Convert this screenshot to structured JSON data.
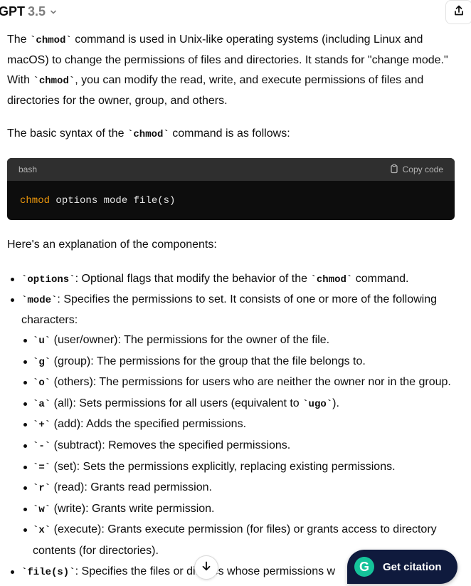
{
  "header": {
    "model_name": "GPT",
    "model_version": "3.5"
  },
  "intro": {
    "p1": [
      {
        "t": "The "
      },
      {
        "c": "`chmod`"
      },
      {
        "t": " command is used in Unix-like operating systems (including Linux and macOS) to change the permissions of files and directories. It stands for \"change mode.\" With "
      },
      {
        "c": "`chmod`"
      },
      {
        "t": ", you can modify the read, write, and execute permissions of files and directories for the owner, group, and others."
      }
    ],
    "p2": [
      {
        "t": "The basic syntax of the "
      },
      {
        "c": "`chmod`"
      },
      {
        "t": " command is as follows:"
      }
    ]
  },
  "code_block": {
    "language": "bash",
    "copy_label": "Copy code",
    "keyword": "chmod",
    "rest": " options mode file(s)"
  },
  "explanation_heading": "Here's an explanation of the components:",
  "items": [
    {
      "parts": [
        {
          "c": "`options`"
        },
        {
          "t": ": Optional flags that modify the behavior of the "
        },
        {
          "c": "`chmod`"
        },
        {
          "t": " command."
        }
      ]
    },
    {
      "parts": [
        {
          "c": "`mode`"
        },
        {
          "t": ": Specifies the permissions to set. It consists of one or more of the following characters:"
        }
      ],
      "sub": [
        {
          "parts": [
            {
              "c": "`u`"
            },
            {
              "t": " (user/owner): The permissions for the owner of the file."
            }
          ]
        },
        {
          "parts": [
            {
              "c": "`g`"
            },
            {
              "t": " (group): The permissions for the group that the file belongs to."
            }
          ]
        },
        {
          "parts": [
            {
              "c": "`o`"
            },
            {
              "t": " (others): The permissions for users who are neither the owner nor in the group."
            }
          ]
        },
        {
          "parts": [
            {
              "c": "`a`"
            },
            {
              "t": " (all): Sets permissions for all users (equivalent to "
            },
            {
              "c": "`ugo`"
            },
            {
              "t": ")."
            }
          ]
        },
        {
          "parts": [
            {
              "c": "`+`"
            },
            {
              "t": " (add): Adds the specified permissions."
            }
          ]
        },
        {
          "parts": [
            {
              "c": "`-`"
            },
            {
              "t": " (subtract): Removes the specified permissions."
            }
          ]
        },
        {
          "parts": [
            {
              "c": "`=`"
            },
            {
              "t": " (set): Sets the permissions explicitly, replacing existing permissions."
            }
          ]
        },
        {
          "parts": [
            {
              "c": "`r`"
            },
            {
              "t": " (read): Grants read permission."
            }
          ]
        },
        {
          "parts": [
            {
              "c": "`w`"
            },
            {
              "t": " (write): Grants write permission."
            }
          ]
        },
        {
          "parts": [
            {
              "c": "`x`"
            },
            {
              "t": " (execute): Grants execute permission (for files) or grants access to directory contents (for directories)."
            }
          ]
        }
      ]
    },
    {
      "parts": [
        {
          "c": "`file(s)`"
        },
        {
          "t": ": Specifies the files or dir"
        },
        {
          "t": "ories whose permissions w"
        }
      ]
    }
  ],
  "citation_button": {
    "label": "Get citation",
    "logo": "G"
  },
  "icons": {
    "share": "share-icon",
    "scroll": "arrow-down-icon",
    "chevron": "chevron-down-icon",
    "copy": "clipboard-icon"
  },
  "colors": {
    "code_keyword": "#e9950c",
    "citation_bg": "#0f1a3d",
    "grammarly_green": "#15c39a"
  }
}
